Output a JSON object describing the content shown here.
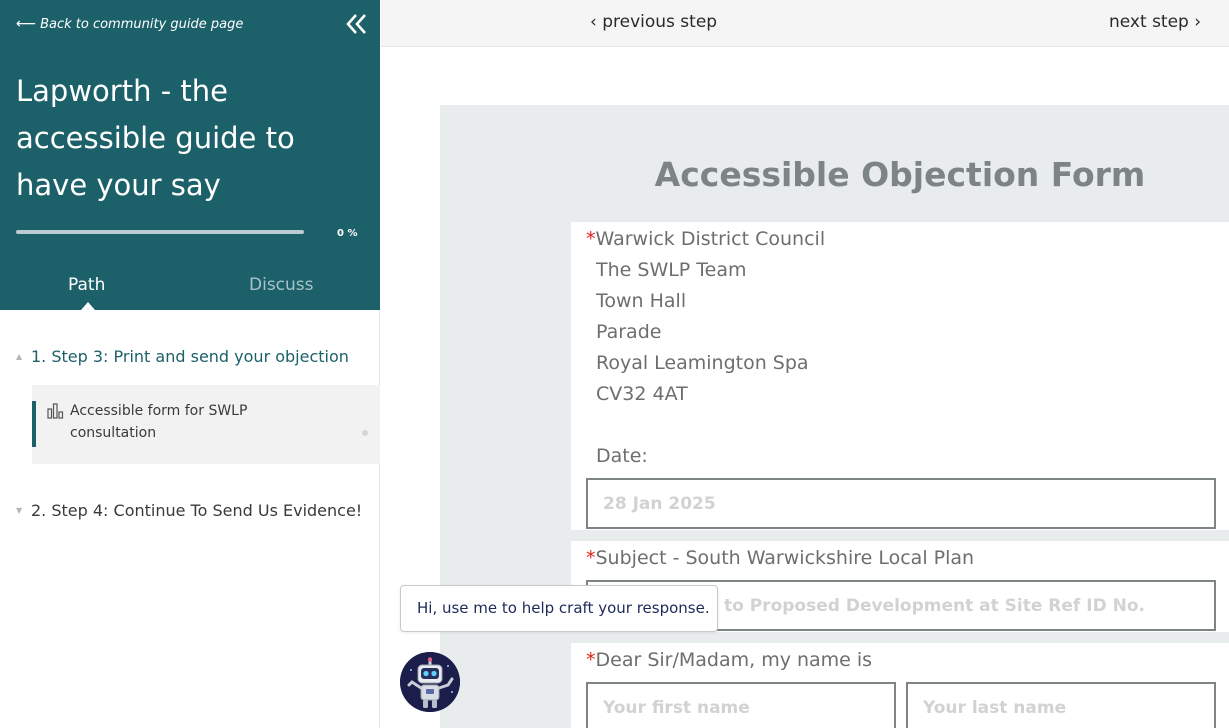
{
  "sidebar": {
    "back_link": "Back to community guide page",
    "title": "Lapworth - the accessible guide to have your say",
    "progress": {
      "value": 0,
      "label": "0 %"
    },
    "tabs": [
      {
        "label": "Path",
        "active": true
      },
      {
        "label": "Discuss",
        "active": false
      }
    ],
    "steps": [
      {
        "label": "1. Step 3: Print and send your objection",
        "expanded": true,
        "substeps": [
          {
            "label": "Accessible form for SWLP consultation",
            "icon": "bar-chart-icon",
            "active": true
          }
        ]
      },
      {
        "label": "2. Step 4: Continue To Send Us Evidence!",
        "expanded": false
      }
    ]
  },
  "nav": {
    "previous": "previous step",
    "next": "next step"
  },
  "form": {
    "title": "Accessible Objection Form",
    "recipient": {
      "required_mark": "*",
      "line1": "Warwick District Council",
      "lines": [
        "The SWLP Team",
        "Town Hall",
        "Parade",
        "Royal Leamington Spa",
        "CV32 4AT"
      ]
    },
    "date": {
      "label": "Date:",
      "value": "28 Jan 2025"
    },
    "subject": {
      "required_mark": "*",
      "label": "Subject - South Warwickshire Local Plan",
      "placeholder_visible": "to Proposed Development at Site Ref ID No."
    },
    "salutation": {
      "required_mark": "*",
      "label": "Dear Sir/Madam, my name is",
      "first_name_placeholder": "Your first name",
      "last_name_placeholder": "Your last name"
    }
  },
  "assistant": {
    "tooltip": "Hi, use me to help craft your response.",
    "avatar_icon": "robot-icon"
  },
  "colors": {
    "sidebar_header": "#1c6169",
    "form_background": "#e9ecec",
    "required": "#e0201b",
    "title_gray": "#7d8584"
  }
}
